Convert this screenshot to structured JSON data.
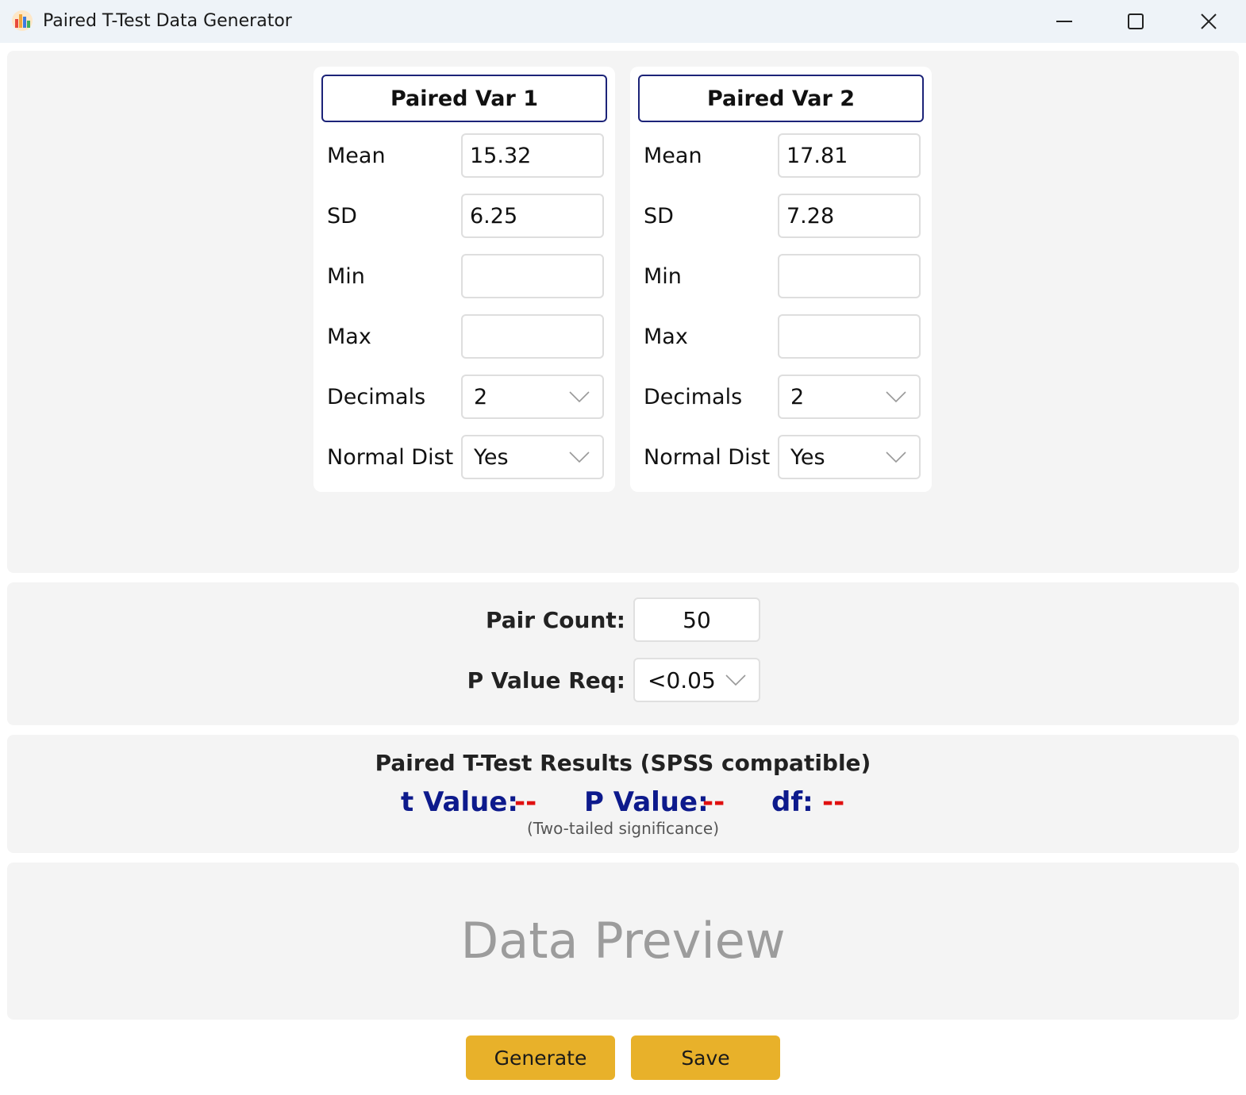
{
  "window": {
    "title": "Paired T-Test Data Generator"
  },
  "colors": {
    "accent_button": "#e8b12a",
    "result_label": "#0d1a8c",
    "result_value": "#e01010",
    "card_border": "#1c2378"
  },
  "var1": {
    "header": "Paired Var 1",
    "mean_label": "Mean",
    "mean_value": "15.32",
    "sd_label": "SD",
    "sd_value": "6.25",
    "min_label": "Min",
    "min_value": "",
    "max_label": "Max",
    "max_value": "",
    "decimals_label": "Decimals",
    "decimals_value": "2",
    "normal_label": "Normal Dist",
    "normal_value": "Yes"
  },
  "var2": {
    "header": "Paired Var 2",
    "mean_label": "Mean",
    "mean_value": "17.81",
    "sd_label": "SD",
    "sd_value": "7.28",
    "min_label": "Min",
    "min_value": "",
    "max_label": "Max",
    "max_value": "",
    "decimals_label": "Decimals",
    "decimals_value": "2",
    "normal_label": "Normal Dist",
    "normal_value": "Yes"
  },
  "pair": {
    "count_label": "Pair Count:",
    "count_value": "50",
    "p_req_label": "P Value Req:",
    "p_req_value": "<0.05"
  },
  "results": {
    "title": "Paired T-Test Results (SPSS compatible)",
    "t_label": "t Value:",
    "t_value": "--",
    "p_label": "P Value:",
    "p_value": "--",
    "df_label": "df:",
    "df_value": "--",
    "note": "(Two-tailed significance)"
  },
  "preview": {
    "placeholder": "Data Preview"
  },
  "actions": {
    "generate_label": "Generate",
    "save_label": "Save"
  },
  "icons": {
    "app": "bar-chart-icon",
    "minimize": "minimize-icon",
    "maximize": "maximize-icon",
    "close": "close-icon",
    "dropdown": "chevron-down-icon"
  }
}
